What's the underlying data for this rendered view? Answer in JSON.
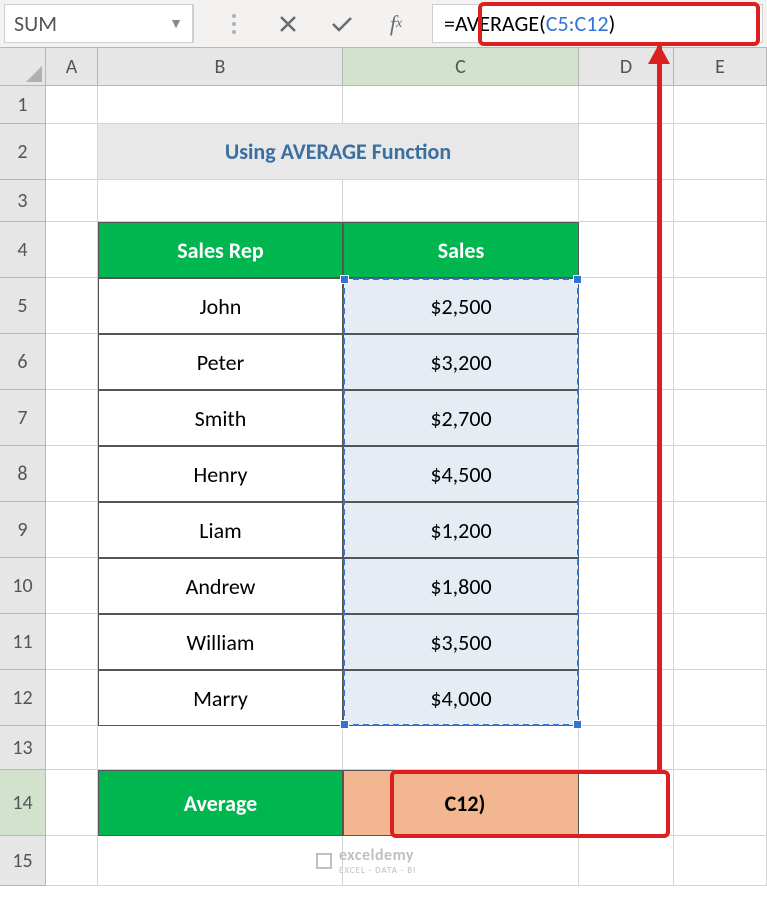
{
  "nameBox": "SUM",
  "formula": {
    "prefix": "=AVERAGE(",
    "ref": "C5:C12",
    "suffix": ")"
  },
  "columns": [
    "A",
    "B",
    "C",
    "D",
    "E"
  ],
  "rows": [
    "1",
    "2",
    "3",
    "4",
    "5",
    "6",
    "7",
    "8",
    "9",
    "10",
    "11",
    "12",
    "13",
    "14",
    "15"
  ],
  "title": "Using AVERAGE Function",
  "tableHead": {
    "b": "Sales Rep",
    "c": "Sales"
  },
  "tableRows": [
    {
      "rep": "John",
      "sales": "$2,500"
    },
    {
      "rep": "Peter",
      "sales": "$3,200"
    },
    {
      "rep": "Smith",
      "sales": "$2,700"
    },
    {
      "rep": "Henry",
      "sales": "$4,500"
    },
    {
      "rep": "Liam",
      "sales": "$1,200"
    },
    {
      "rep": "Andrew",
      "sales": "$1,800"
    },
    {
      "rep": "William",
      "sales": "$3,500"
    },
    {
      "rep": "Marry",
      "sales": "$4,000"
    }
  ],
  "averageLabel": "Average",
  "averageCellDisplay": "C12)",
  "watermark": {
    "brand": "exceldemy",
    "tagline": "EXCEL · DATA · BI"
  }
}
